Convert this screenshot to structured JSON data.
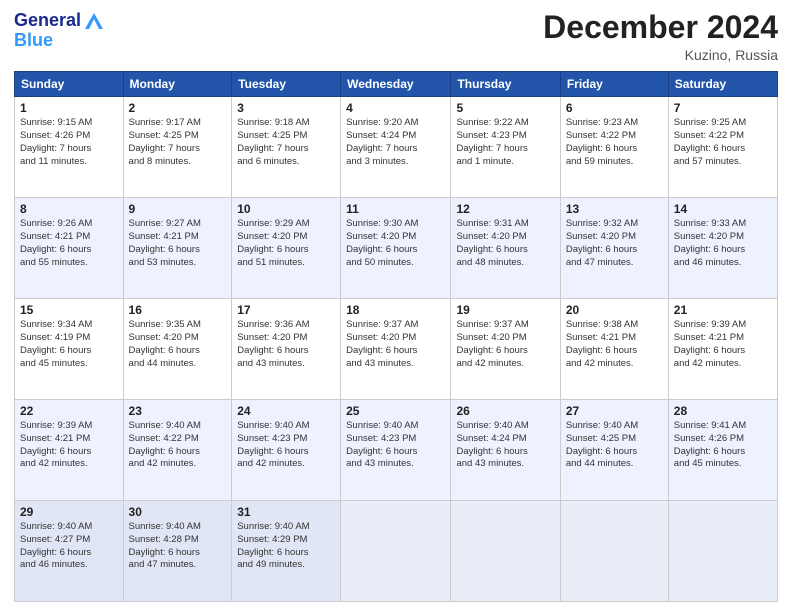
{
  "header": {
    "logo_general": "General",
    "logo_blue": "Blue",
    "month_title": "December 2024",
    "location": "Kuzino, Russia"
  },
  "weekdays": [
    "Sunday",
    "Monday",
    "Tuesday",
    "Wednesday",
    "Thursday",
    "Friday",
    "Saturday"
  ],
  "weeks": [
    [
      {
        "day": "1",
        "info": "Sunrise: 9:15 AM\nSunset: 4:26 PM\nDaylight: 7 hours\nand 11 minutes."
      },
      {
        "day": "2",
        "info": "Sunrise: 9:17 AM\nSunset: 4:25 PM\nDaylight: 7 hours\nand 8 minutes."
      },
      {
        "day": "3",
        "info": "Sunrise: 9:18 AM\nSunset: 4:25 PM\nDaylight: 7 hours\nand 6 minutes."
      },
      {
        "day": "4",
        "info": "Sunrise: 9:20 AM\nSunset: 4:24 PM\nDaylight: 7 hours\nand 3 minutes."
      },
      {
        "day": "5",
        "info": "Sunrise: 9:22 AM\nSunset: 4:23 PM\nDaylight: 7 hours\nand 1 minute."
      },
      {
        "day": "6",
        "info": "Sunrise: 9:23 AM\nSunset: 4:22 PM\nDaylight: 6 hours\nand 59 minutes."
      },
      {
        "day": "7",
        "info": "Sunrise: 9:25 AM\nSunset: 4:22 PM\nDaylight: 6 hours\nand 57 minutes."
      }
    ],
    [
      {
        "day": "8",
        "info": "Sunrise: 9:26 AM\nSunset: 4:21 PM\nDaylight: 6 hours\nand 55 minutes."
      },
      {
        "day": "9",
        "info": "Sunrise: 9:27 AM\nSunset: 4:21 PM\nDaylight: 6 hours\nand 53 minutes."
      },
      {
        "day": "10",
        "info": "Sunrise: 9:29 AM\nSunset: 4:20 PM\nDaylight: 6 hours\nand 51 minutes."
      },
      {
        "day": "11",
        "info": "Sunrise: 9:30 AM\nSunset: 4:20 PM\nDaylight: 6 hours\nand 50 minutes."
      },
      {
        "day": "12",
        "info": "Sunrise: 9:31 AM\nSunset: 4:20 PM\nDaylight: 6 hours\nand 48 minutes."
      },
      {
        "day": "13",
        "info": "Sunrise: 9:32 AM\nSunset: 4:20 PM\nDaylight: 6 hours\nand 47 minutes."
      },
      {
        "day": "14",
        "info": "Sunrise: 9:33 AM\nSunset: 4:20 PM\nDaylight: 6 hours\nand 46 minutes."
      }
    ],
    [
      {
        "day": "15",
        "info": "Sunrise: 9:34 AM\nSunset: 4:19 PM\nDaylight: 6 hours\nand 45 minutes."
      },
      {
        "day": "16",
        "info": "Sunrise: 9:35 AM\nSunset: 4:20 PM\nDaylight: 6 hours\nand 44 minutes."
      },
      {
        "day": "17",
        "info": "Sunrise: 9:36 AM\nSunset: 4:20 PM\nDaylight: 6 hours\nand 43 minutes."
      },
      {
        "day": "18",
        "info": "Sunrise: 9:37 AM\nSunset: 4:20 PM\nDaylight: 6 hours\nand 43 minutes."
      },
      {
        "day": "19",
        "info": "Sunrise: 9:37 AM\nSunset: 4:20 PM\nDaylight: 6 hours\nand 42 minutes."
      },
      {
        "day": "20",
        "info": "Sunrise: 9:38 AM\nSunset: 4:21 PM\nDaylight: 6 hours\nand 42 minutes."
      },
      {
        "day": "21",
        "info": "Sunrise: 9:39 AM\nSunset: 4:21 PM\nDaylight: 6 hours\nand 42 minutes."
      }
    ],
    [
      {
        "day": "22",
        "info": "Sunrise: 9:39 AM\nSunset: 4:21 PM\nDaylight: 6 hours\nand 42 minutes."
      },
      {
        "day": "23",
        "info": "Sunrise: 9:40 AM\nSunset: 4:22 PM\nDaylight: 6 hours\nand 42 minutes."
      },
      {
        "day": "24",
        "info": "Sunrise: 9:40 AM\nSunset: 4:23 PM\nDaylight: 6 hours\nand 42 minutes."
      },
      {
        "day": "25",
        "info": "Sunrise: 9:40 AM\nSunset: 4:23 PM\nDaylight: 6 hours\nand 43 minutes."
      },
      {
        "day": "26",
        "info": "Sunrise: 9:40 AM\nSunset: 4:24 PM\nDaylight: 6 hours\nand 43 minutes."
      },
      {
        "day": "27",
        "info": "Sunrise: 9:40 AM\nSunset: 4:25 PM\nDaylight: 6 hours\nand 44 minutes."
      },
      {
        "day": "28",
        "info": "Sunrise: 9:41 AM\nSunset: 4:26 PM\nDaylight: 6 hours\nand 45 minutes."
      }
    ],
    [
      {
        "day": "29",
        "info": "Sunrise: 9:40 AM\nSunset: 4:27 PM\nDaylight: 6 hours\nand 46 minutes."
      },
      {
        "day": "30",
        "info": "Sunrise: 9:40 AM\nSunset: 4:28 PM\nDaylight: 6 hours\nand 47 minutes."
      },
      {
        "day": "31",
        "info": "Sunrise: 9:40 AM\nSunset: 4:29 PM\nDaylight: 6 hours\nand 49 minutes."
      },
      {
        "day": "",
        "info": ""
      },
      {
        "day": "",
        "info": ""
      },
      {
        "day": "",
        "info": ""
      },
      {
        "day": "",
        "info": ""
      }
    ]
  ]
}
